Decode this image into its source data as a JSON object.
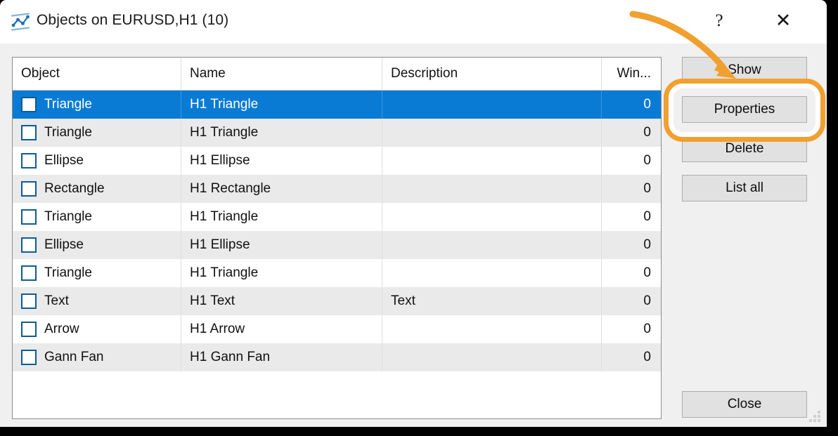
{
  "window": {
    "title": "Objects on EURUSD,H1 (10)",
    "icon": "chart-line-icon",
    "help_label": "?",
    "close_label": "✕"
  },
  "table": {
    "columns": [
      {
        "key": "object",
        "label": "Object"
      },
      {
        "key": "name",
        "label": "Name"
      },
      {
        "key": "description",
        "label": "Description"
      },
      {
        "key": "window",
        "label": "Win..."
      }
    ],
    "rows": [
      {
        "object": "Triangle",
        "name": "H1 Triangle",
        "description": "",
        "window": "0",
        "selected": true,
        "checked": false
      },
      {
        "object": "Triangle",
        "name": "H1 Triangle",
        "description": "",
        "window": "0",
        "selected": false,
        "checked": false
      },
      {
        "object": "Ellipse",
        "name": "H1 Ellipse",
        "description": "",
        "window": "0",
        "selected": false,
        "checked": false
      },
      {
        "object": "Rectangle",
        "name": "H1 Rectangle",
        "description": "",
        "window": "0",
        "selected": false,
        "checked": false
      },
      {
        "object": "Triangle",
        "name": "H1 Triangle",
        "description": "",
        "window": "0",
        "selected": false,
        "checked": false
      },
      {
        "object": "Ellipse",
        "name": "H1 Ellipse",
        "description": "",
        "window": "0",
        "selected": false,
        "checked": false
      },
      {
        "object": "Triangle",
        "name": "H1 Triangle",
        "description": "",
        "window": "0",
        "selected": false,
        "checked": false
      },
      {
        "object": "Text",
        "name": "H1 Text",
        "description": "Text",
        "window": "0",
        "selected": false,
        "checked": false
      },
      {
        "object": "Arrow",
        "name": "H1 Arrow",
        "description": "",
        "window": "0",
        "selected": false,
        "checked": false
      },
      {
        "object": "Gann Fan",
        "name": "H1 Gann Fan",
        "description": "",
        "window": "0",
        "selected": false,
        "checked": false
      }
    ]
  },
  "buttons": {
    "show": "Show",
    "properties": "Properties",
    "delete": "Delete",
    "list_all": "List all",
    "close": "Close"
  },
  "annotation": {
    "accent_color": "#F0A030",
    "ring_target": "properties-button",
    "arrow": "curved-arrow-pointing-to-properties-button"
  },
  "colors": {
    "selection_blue": "#0A7BD4",
    "checkbox_border": "#0F5A96",
    "row_alt": "#EAEAEA",
    "button_face": "#E1E1E1",
    "window_face": "#F0F0F0"
  }
}
